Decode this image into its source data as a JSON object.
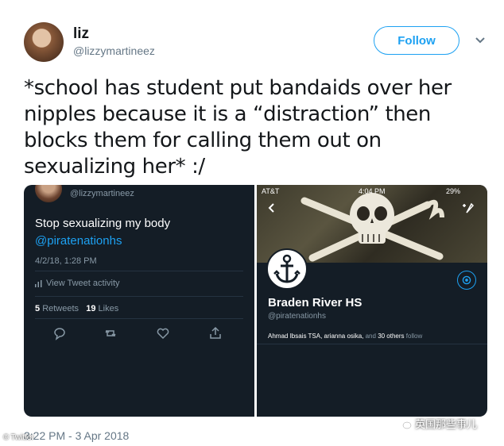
{
  "author": {
    "name": "liz",
    "handle": "@lizzymartineez",
    "follow_label": "Follow"
  },
  "tweet": {
    "text": "*school has student put bandaids over her nipples because it is a “distraction” then blocks them for calling them out on sexualizing her* :/",
    "timestamp": "3:22 PM - 3 Apr 2018"
  },
  "left_screenshot": {
    "handle": "@lizzymartineez",
    "text": "Stop sexualizing my body",
    "mention": "@piratenationhs",
    "date": "4/2/18, 1:28 PM",
    "activity_label": "View Tweet activity",
    "retweets_count": "5",
    "retweets_label": "Retweets",
    "likes_count": "19",
    "likes_label": "Likes"
  },
  "right_screenshot": {
    "carrier": "AT&T",
    "time": "4:04 PM",
    "battery": "29%",
    "profile_name": "Braden River HS",
    "profile_handle": "@piratenationhs",
    "followed_by_names": "Ahmad Ibsais TSA, arianna osika,",
    "followed_by_and": "and",
    "followed_by_others": "30 others",
    "followed_by_suffix": "follow"
  },
  "watermarks": {
    "left": "Twitter",
    "right": "英国那些事儿"
  },
  "colors": {
    "accent": "#1da1f2",
    "dark_bg": "#141d26",
    "muted": "#657786"
  },
  "icons": [
    "chevron-down-icon",
    "chart-bars-icon",
    "reply-icon",
    "retweet-icon",
    "like-icon",
    "share-icon",
    "back-arrow-icon",
    "compose-icon",
    "gear-icon",
    "anchor-icon",
    "skull-flag-icon"
  ]
}
